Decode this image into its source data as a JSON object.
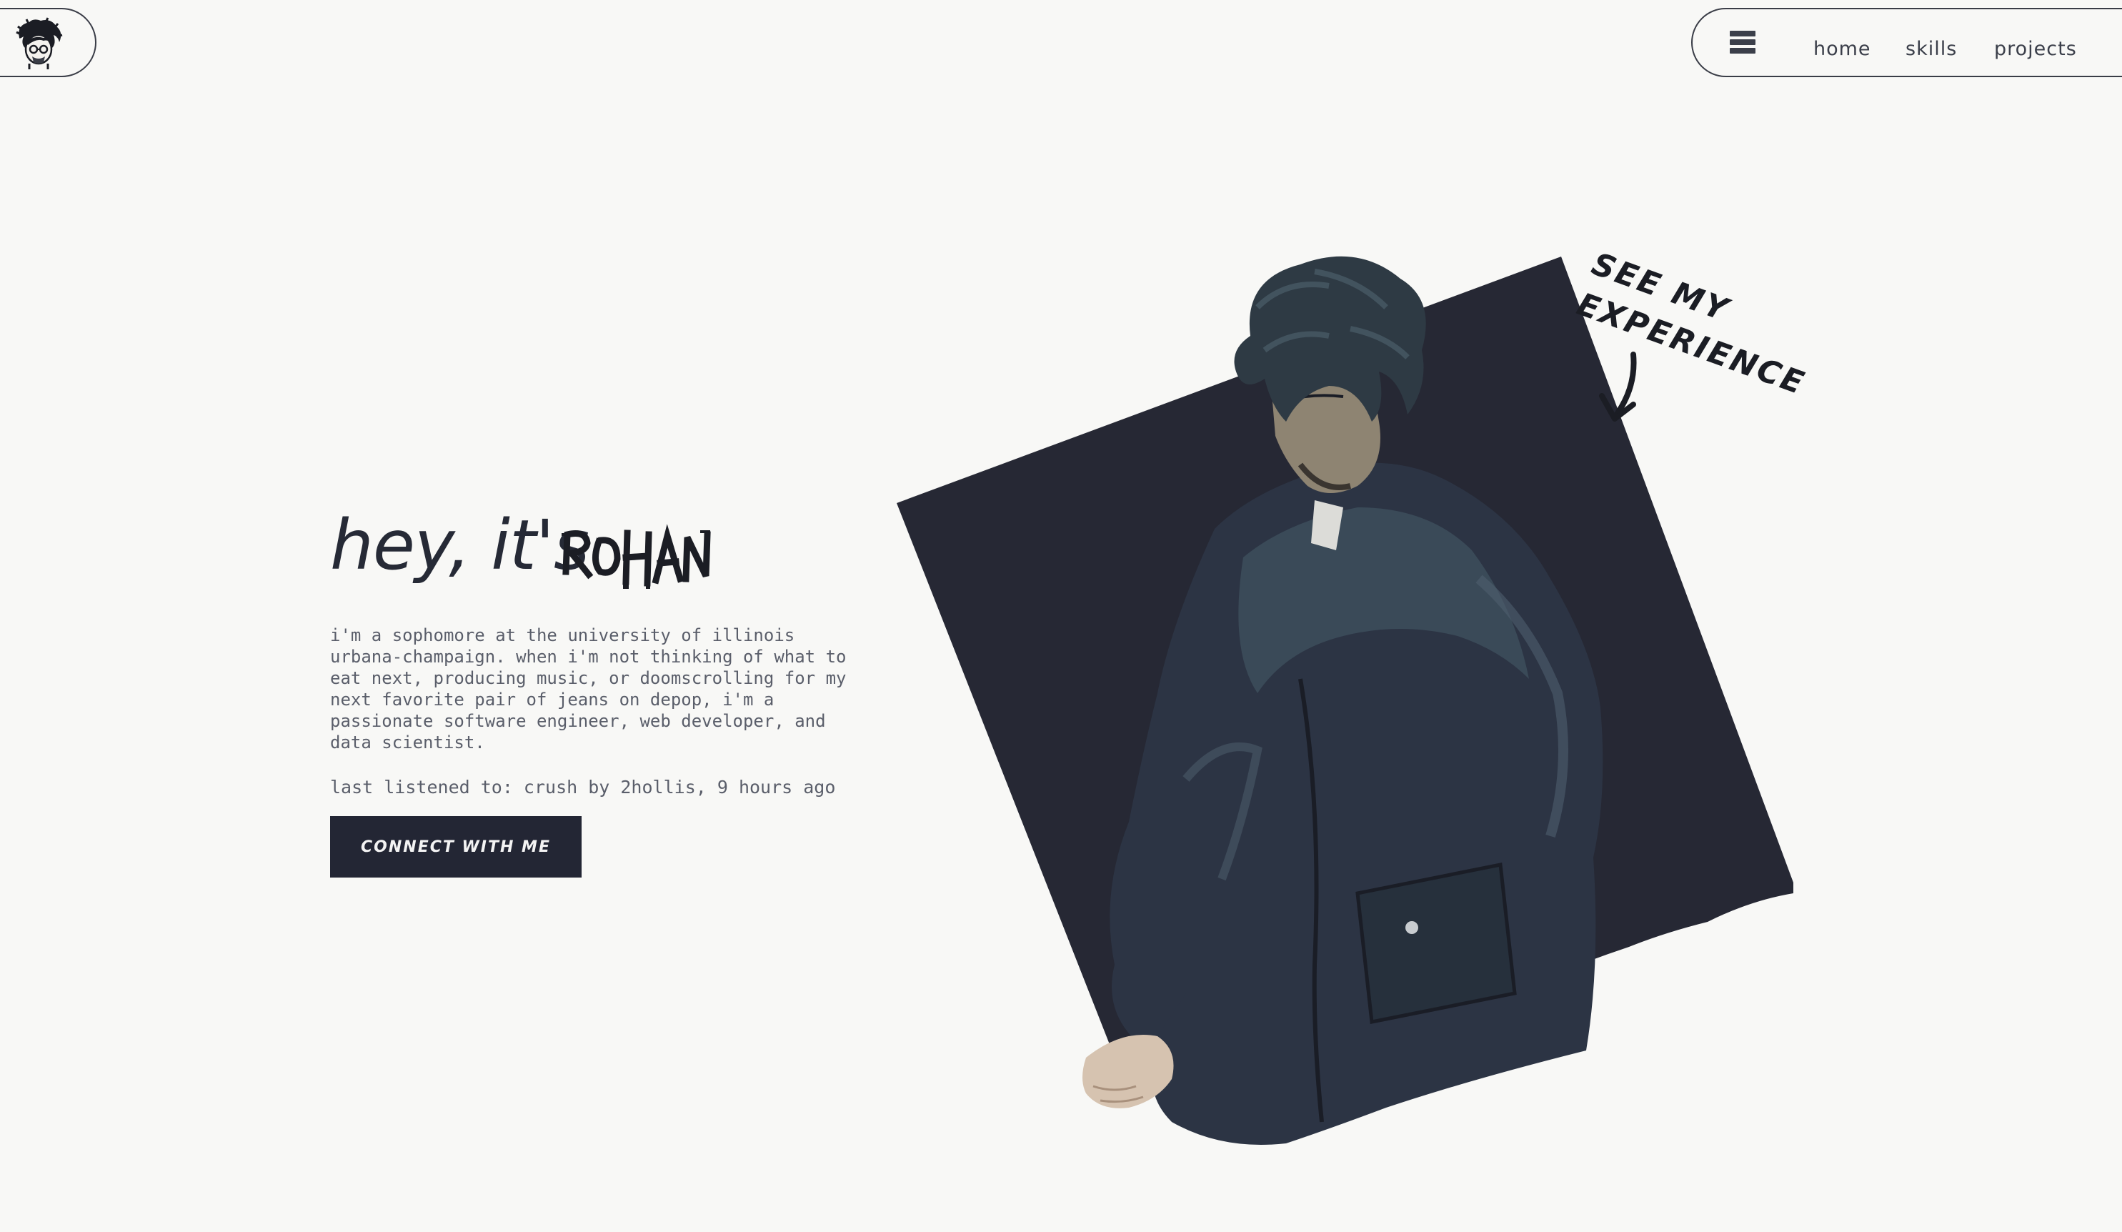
{
  "header": {
    "logo_name": "avatar-logo",
    "menu_icon": "hamburger-menu-icon",
    "nav": [
      {
        "label": "home"
      },
      {
        "label": "skills"
      },
      {
        "label": "projects"
      }
    ]
  },
  "hero": {
    "greeting": "hey, it's",
    "name_graffiti": "ROHAN",
    "bio": "i'm a sophomore at the university of illinois urbana-champaign. when i'm not thinking of what to eat next, producing music, or doomscrolling for my next favorite pair of jeans on depop, i'm a passionate software engineer, web developer, and data scientist.",
    "last_listened": "last listened to: crush by 2hollis, 9 hours ago",
    "cta_label": "CONNECT WITH ME"
  },
  "experience": {
    "label": "SEE MY EXPERIENCE",
    "arrow_icon": "arrow-down-icon"
  },
  "colors": {
    "background": "#f8f8f6",
    "dark_navy": "#232634",
    "text": "#262a36",
    "muted": "#5a5e6a"
  }
}
